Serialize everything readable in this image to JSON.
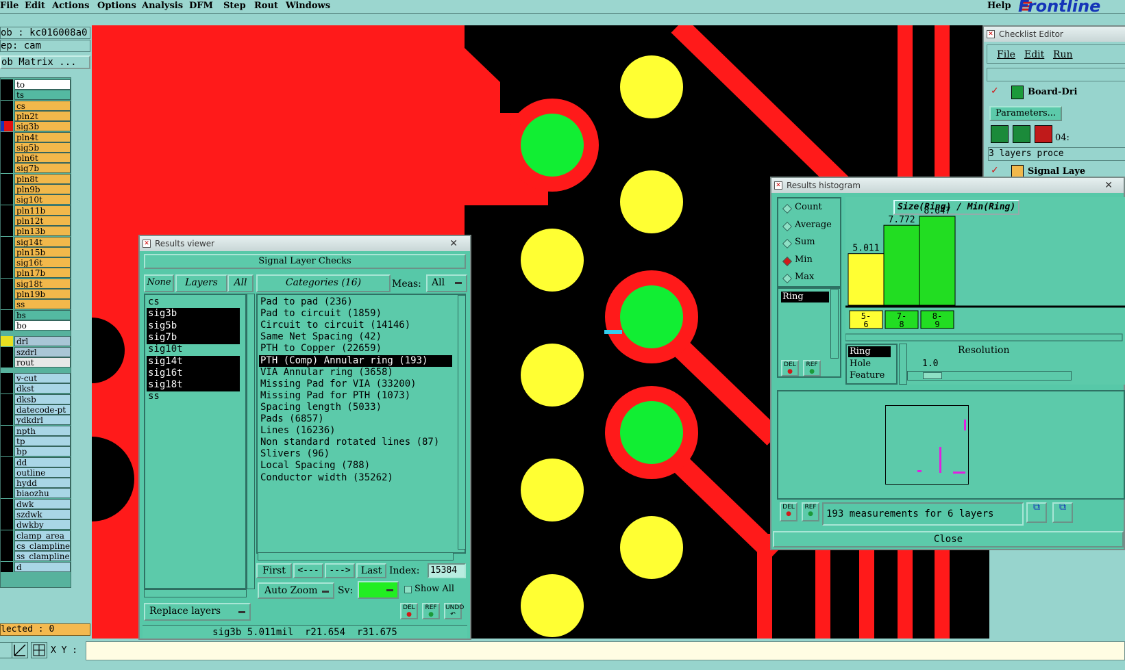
{
  "menubar": {
    "items": [
      "File",
      "Edit",
      "Actions",
      "Options",
      "Analysis",
      "DFM",
      "Step",
      "Rout",
      "Windows"
    ],
    "help": "Help",
    "brand": "Frontline"
  },
  "left_panel": {
    "job": "ob : kc016008a0",
    "step": "ep: cam",
    "job_matrix": "ob Matrix ...",
    "layers_board": [
      "to",
      "ts",
      "cs",
      "pln2t",
      "sig3b",
      "pln4t",
      "sig5b",
      "pln6t",
      "sig7b",
      "pln8t",
      "pln9b",
      "sig10t",
      "pln11b",
      "pln12t",
      "pln13b",
      "sig14t",
      "pln15b",
      "sig16t",
      "pln17b",
      "sig18t",
      "pln19b",
      "ss",
      "bs",
      "bo"
    ],
    "layers_drill": [
      "drl",
      "szdrl",
      "rout"
    ],
    "layers_misc": [
      "v-cut",
      "dkst",
      "dksb",
      "datecode-pt",
      "ydkdrl",
      "npth",
      "tp",
      "bp",
      "dd",
      "outline",
      "hydd",
      "biaozhu",
      "dwk",
      "szdwk",
      "dwkby",
      "clamp_area",
      "cs_clampline",
      "ss_clampline",
      "d"
    ],
    "selected": "lected : 0",
    "xy_label": "X Y :"
  },
  "results_viewer": {
    "title": "Results viewer",
    "header": "Signal Layer Checks",
    "none_btn": "None",
    "layers_btn": "Layers",
    "all_btn": "All",
    "categories_btn": "Categories (16)",
    "meas_label": "Meas:",
    "meas_value": "All",
    "layers": [
      "cs",
      "sig3b",
      "sig5b",
      "sig7b",
      "sig10t",
      "sig14t",
      "sig16t",
      "sig18t",
      "ss"
    ],
    "layers_selected": [
      "sig3b",
      "sig5b",
      "sig7b",
      "sig14t",
      "sig16t",
      "sig18t"
    ],
    "categories": [
      "Pad to pad (236)",
      "Pad to circuit (1859)",
      "Circuit to circuit (14146)",
      "Same Net Spacing (42)",
      "PTH to Copper (22659)",
      "PTH (Comp) Annular ring (193)",
      "VIA Annular ring (3658)",
      "Missing Pad for VIA (33200)",
      "Missing Pad for PTH (1073)",
      "Spacing length (5033)",
      "Pads (6857)",
      "Lines (16236)",
      "Non standard rotated lines (87)",
      "Slivers (96)",
      "Local Spacing (788)",
      "Conductor width (35262)"
    ],
    "category_selected": "PTH (Comp) Annular ring (193)",
    "first_btn": "First",
    "prev_btn": "<---",
    "next_btn": "--->",
    "last_btn": "Last",
    "index_label": "Index:",
    "index_value": "15384",
    "auto_zoom_btn": "Auto Zoom",
    "sv_label": "Sv:",
    "show_all_label": "Show All",
    "replace_layers_btn": "Replace layers",
    "status": "sig3b 5.011mil  r21.654  r31.675",
    "del_icon": "DEL",
    "ref_icon": "REF",
    "undo_icon": "UNDO"
  },
  "histogram": {
    "title": "Results histogram",
    "modes": [
      "Count",
      "Average",
      "Sum",
      "Min",
      "Max"
    ],
    "mode_selected": "Min",
    "list_item": "Ring",
    "chart_title": "Size(Ring) / Min(Ring)",
    "measure_list": [
      "Ring",
      "Hole",
      "Feature"
    ],
    "resolution_label": "Resolution",
    "resolution_value": "1.0",
    "summary": "193 measurements for 6 layers",
    "close_btn": "Close",
    "del_icon": "DEL",
    "ref_icon": "REF"
  },
  "chart_data": {
    "type": "bar",
    "title": "Size(Ring) / Min(Ring)",
    "categories": [
      "5-6",
      "7-8",
      "8-9"
    ],
    "values": [
      5.011,
      7.772,
      8.647
    ],
    "colors": [
      "#ffff33",
      "#22dd22",
      "#22dd22"
    ]
  },
  "checklist_editor": {
    "title": "Checklist Editor",
    "menu": [
      "File",
      "Edit",
      "Run"
    ],
    "item1": "Board-Dri",
    "parameters_btn": "Parameters...",
    "time": "04:",
    "status": "3 layers proce",
    "item2": "Signal Laye"
  },
  "colors": {
    "copper": "#ff1a1a",
    "pad_yellow": "#ffff33",
    "pad_green": "#11ee33",
    "background": "#000000",
    "panel": "#5ccaaa",
    "layer_orange": "#f2b84b",
    "layer_teal": "#54b9a2"
  }
}
